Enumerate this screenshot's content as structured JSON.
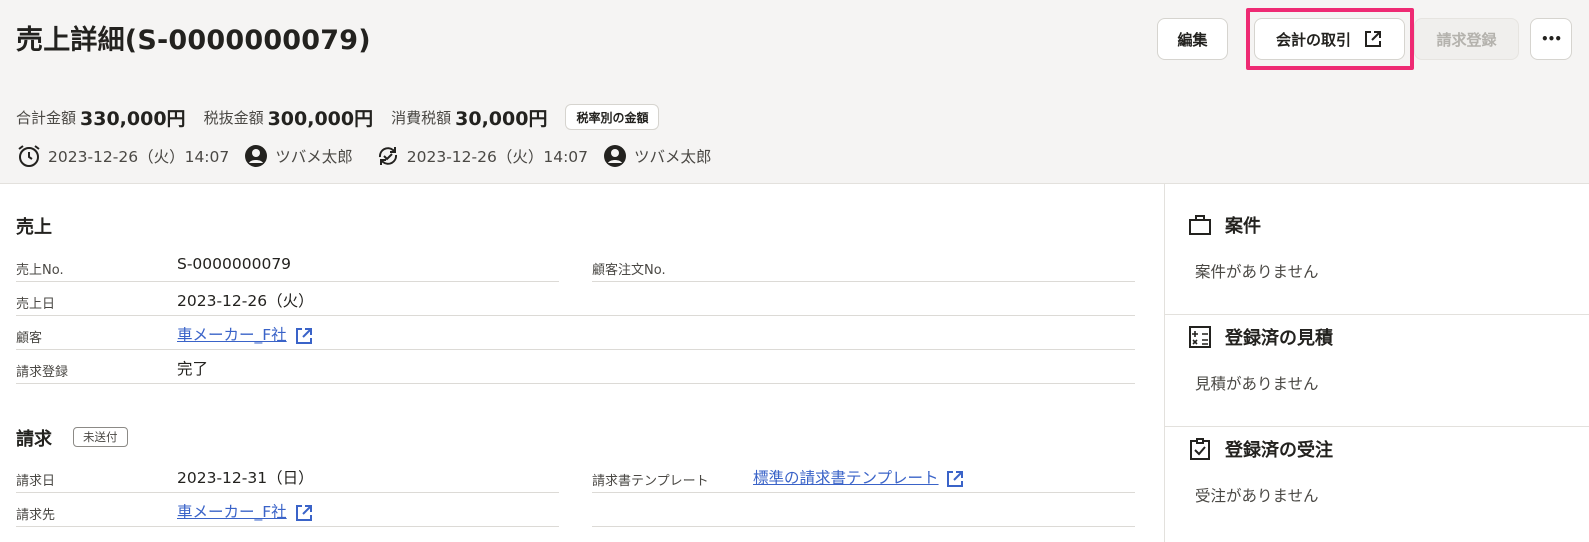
{
  "header": {
    "title": "売上詳細(S-0000000079)",
    "buttons": {
      "edit": "編集",
      "accounting": "会計の取引",
      "billing": "請求登録",
      "more": "•••"
    },
    "amounts": {
      "total_label": "合計金額",
      "total_value": "330,000円",
      "pretax_label": "税抜金額",
      "pretax_value": "300,000円",
      "tax_label": "消費税額",
      "tax_value": "30,000円",
      "tax_rate_button": "税率別の金額"
    },
    "meta": {
      "created_at": "2023-12-26（火）14:07",
      "created_by": "ツバメ太郎",
      "updated_at": "2023-12-26（火）14:07",
      "updated_by": "ツバメ太郎"
    }
  },
  "sales": {
    "title": "売上",
    "rows": [
      {
        "label": "売上No.",
        "value": "S-0000000079"
      },
      {
        "label": "売上日",
        "value": "2023-12-26（火）"
      },
      {
        "label": "顧客",
        "value": "車メーカー_F社"
      },
      {
        "label": "請求登録",
        "value": "完了"
      }
    ],
    "customer_order_label": "顧客注文No.",
    "customer_order_value": ""
  },
  "billing": {
    "title": "請求",
    "status_badge": "未送付",
    "rows": [
      {
        "label": "請求日",
        "value": "2023-12-31（日）"
      },
      {
        "label": "請求先",
        "value": "車メーカー_F社"
      }
    ],
    "template_label": "請求書テンプレート",
    "template_value": "標準の請求書テンプレート"
  },
  "sidebar": {
    "project": {
      "title": "案件",
      "empty": "案件がありません"
    },
    "estimate": {
      "title": "登録済の見積",
      "empty": "見積がありません"
    },
    "order": {
      "title": "登録済の受注",
      "empty": "受注がありません"
    }
  },
  "colors": {
    "accent_link": "#3a63c8",
    "highlight": "#ee2a73"
  }
}
